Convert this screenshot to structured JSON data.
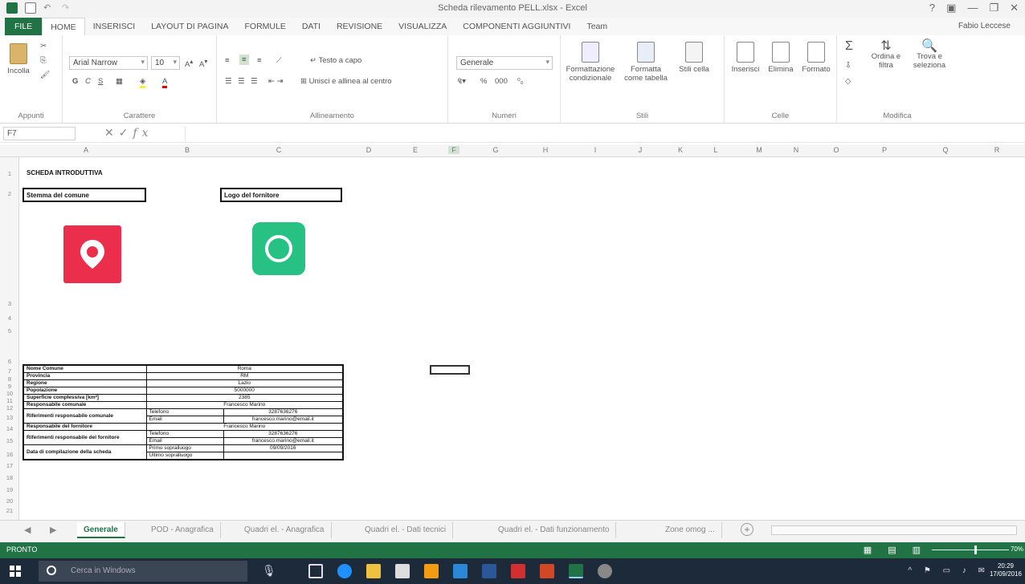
{
  "window": {
    "title": "Scheda rilevamento PELL.xlsx - Excel",
    "controls": [
      "?",
      "▣",
      "—",
      "❐",
      "✕"
    ]
  },
  "ribbon": {
    "tabs": [
      "FILE",
      "HOME",
      "INSERISCI",
      "LAYOUT DI PAGINA",
      "FORMULE",
      "DATI",
      "REVISIONE",
      "VISUALIZZA",
      "COMPONENTI AGGIUNTIVI",
      "Team"
    ],
    "active_tab": "HOME",
    "account": "Fabio Leccese",
    "clipboard": {
      "paste": "Incolla",
      "label": "Appunti"
    },
    "font": {
      "name": "Arial Narrow",
      "size": "10",
      "bold": "G",
      "italic": "C",
      "underline": "S",
      "label": "Carattere"
    },
    "alignment": {
      "wrap": "Testo a capo",
      "merge": "Unisci e allinea al centro",
      "label": "Allineamento"
    },
    "number": {
      "format": "Generale",
      "label": "Numeri"
    },
    "styles": {
      "conditional": "Formattazione condizionale",
      "as_table": "Formatta come tabella",
      "cell_styles": "Stili cella",
      "label": "Stili"
    },
    "cells": {
      "insert": "Inserisci",
      "delete": "Elimina",
      "format": "Formato",
      "label": "Celle"
    },
    "editing": {
      "sort": "Ordina e filtra",
      "find": "Trova e seleziona",
      "label": "Modifica"
    }
  },
  "formula_bar": {
    "name_box": "F7",
    "fx": "fx",
    "content": ""
  },
  "columns": [
    "A",
    "B",
    "C",
    "D",
    "E",
    "F",
    "G",
    "H",
    "I",
    "J",
    "K",
    "L",
    "M",
    "N",
    "O",
    "P",
    "Q",
    "R"
  ],
  "rows": [
    "1",
    "2",
    "3",
    "4",
    "5",
    "6",
    "7",
    "8",
    "9",
    "10",
    "11",
    "12",
    "13",
    "14",
    "15",
    "16",
    "17",
    "18",
    "19",
    "20",
    "21"
  ],
  "sheet": {
    "title": "SCHEDA INTRODUTTIVA",
    "stemma_label": "Stemma del comune",
    "logo_label": "Logo del fornitore",
    "table": [
      {
        "label": "Nome Comune",
        "value": "Roma"
      },
      {
        "label": "Provincia",
        "value": "RM"
      },
      {
        "label": "Regione",
        "value": "Lazio"
      },
      {
        "label": "Popolazione",
        "value": "5000000"
      },
      {
        "label": "Superficie complessiva [km²]",
        "value": "2385"
      },
      {
        "label": "Responsabile comunale",
        "value": "Francesco Marino"
      },
      {
        "label": "Riferimenti responsabile comunale",
        "sub": [
          {
            "key": "Telefono",
            "value": "3287636276"
          },
          {
            "key": "Email",
            "value": "francesco.marino@email.it"
          }
        ]
      },
      {
        "label": "Responsabile del fornitore",
        "value": "Francesco Marino"
      },
      {
        "label": "Riferimenti responsabile del fornitore",
        "sub": [
          {
            "key": "Telefono",
            "value": "3287636276"
          },
          {
            "key": "Email",
            "value": "francesco.marino@email.it"
          }
        ]
      },
      {
        "label": "Data di compilazione della scheda",
        "sub": [
          {
            "key": "Primo sopralluogo",
            "value": "09/09/2016"
          },
          {
            "key": "Ultimo sopralluogo",
            "value": ""
          }
        ]
      }
    ]
  },
  "sheet_tabs": [
    "Generale",
    "POD - Anagrafica",
    "Quadri el. - Anagrafica",
    "Quadri el. - Dati tecnici",
    "Quadri el. - Dati funzionamento",
    "Zone omog ..."
  ],
  "active_sheet": "Generale",
  "status": {
    "mode": "PRONTO",
    "zoom": "70%"
  },
  "taskbar": {
    "search_placeholder": "Cerca in Windows",
    "time": "20:29",
    "date": "17/09/2016"
  },
  "colors": {
    "excel_green": "#217346",
    "stemma_red": "#ea2e4b",
    "logo_green": "#26c183"
  }
}
